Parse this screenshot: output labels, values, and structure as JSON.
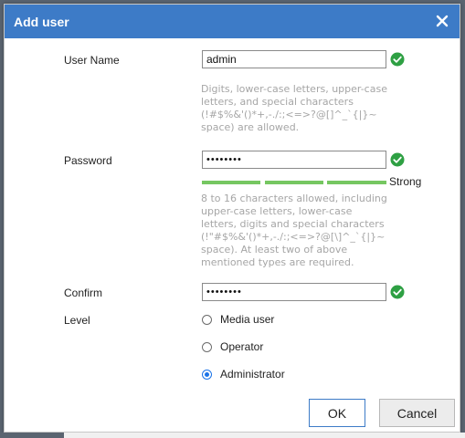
{
  "dialog": {
    "title": "Add user",
    "close_icon": "close-icon"
  },
  "fields": {
    "username": {
      "label": "User Name",
      "value": "admin",
      "hint": "Digits, lower-case letters, upper-case letters, and special characters (!#$%&'()*+,-./:;<=>?@[]^_`{|}~ space) are allowed."
    },
    "password": {
      "label": "Password",
      "value": "••••••••",
      "strength": "Strong",
      "hint": "8 to 16 characters allowed, including upper-case letters, lower-case letters, digits and special characters (!\"#$%&'()*+,-./:;<=>?@[\\]^_`{|}~ space). At least two of above mentioned types are required."
    },
    "confirm": {
      "label": "Confirm",
      "value": "••••••••"
    }
  },
  "level": {
    "label": "Level",
    "options": [
      "Media user",
      "Operator",
      "Administrator"
    ],
    "selected": "Administrator"
  },
  "buttons": {
    "ok": "OK",
    "cancel": "Cancel"
  },
  "colors": {
    "titlebar": "#3d7bc7",
    "valid_check": "#2ea043",
    "strength_bar": "#76c761",
    "radio_selected": "#1a73e8"
  }
}
